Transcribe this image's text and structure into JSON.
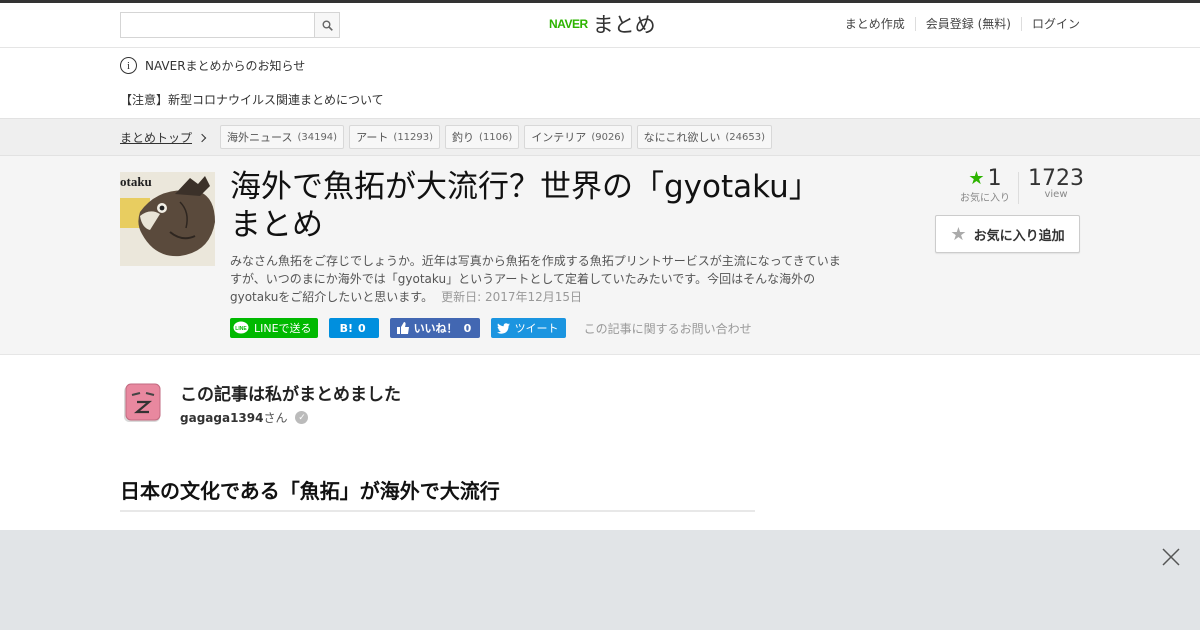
{
  "header": {
    "search_placeholder": "",
    "logo_brand": "NAVER",
    "logo_text": "まとめ",
    "nav": [
      "まとめ作成",
      "会員登録 (無料)",
      "ログイン"
    ]
  },
  "notice": {
    "label": "NAVERまとめからのお知らせ",
    "link": "【注意】新型コロナウイルス関連まとめについて"
  },
  "breadcrumb": {
    "label": "まとめトップ"
  },
  "categories": [
    {
      "name": "海外ニュース",
      "count": "(34194)"
    },
    {
      "name": "アート",
      "count": "(11293)"
    },
    {
      "name": "釣り",
      "count": "(1106)"
    },
    {
      "name": "インテリア",
      "count": "(9026)"
    },
    {
      "name": "なにこれ欲しい",
      "count": "(24653)"
    }
  ],
  "article": {
    "title": "海外で魚拓が大流行？世界の「gyotaku」まとめ",
    "description": "みなさん魚拓をご存じでしょうか。近年は写真から魚拓を作成する魚拓プリントサービスが主流になってきていますが、いつのまにか海外では「gyotaku」というアートとして定着していたみたいです。今回はそんな海外のgyotakuをご紹介したいと思います。",
    "updated": "更新日: 2017年12月15日",
    "thumb_text": "otaku"
  },
  "share": {
    "line": "LINEで送る",
    "hatena_count": "0",
    "fb_label": "いいね！",
    "fb_count": "0",
    "tweet": "ツイート",
    "contact": "この記事に関するお問い合わせ"
  },
  "stats": {
    "favorites": "1",
    "favorites_label": "お気に入り",
    "views": "1723",
    "views_label": "view",
    "add_favorite": "お気に入り追加"
  },
  "author": {
    "heading": "この記事は私がまとめました",
    "name": "gagaga1394",
    "suffix": "さん"
  },
  "section_heading": "日本の文化である「魚拓」が海外で大流行",
  "colors": {
    "brand_green": "#2db400",
    "line_green": "#00b900",
    "hatena_blue": "#008fde",
    "fb_blue": "#4267b2",
    "tw_blue": "#1b95e0"
  }
}
